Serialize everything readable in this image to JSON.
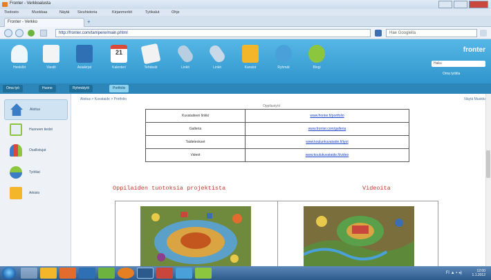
{
  "browser": {
    "window_title": "Fronter - Verkkoalusta",
    "menu": [
      "Tiedosto",
      "Muokkaa",
      "Näytä",
      "Sivuhistoria",
      "Kirjanmerkit",
      "Työkalut",
      "Ohje"
    ],
    "tab_label": "Fronter - Verkko",
    "url": "http://fronter.com/tampere/main.phtml",
    "search_placeholder": "Hae Googlella"
  },
  "app": {
    "brand": "fronter",
    "search_placeholder": "Haku",
    "top_link": "Oma työtila",
    "icons": [
      {
        "label": "Henkilöt",
        "icon": "person-icon",
        "color": "#ffffff"
      },
      {
        "label": "Viestit",
        "icon": "message-icon",
        "color": "#e8d35a"
      },
      {
        "label": "Asiakirjat",
        "icon": "documents-icon",
        "color": "#2f6fb3"
      },
      {
        "label": "Kalenteri",
        "icon": "calendar-icon",
        "color": "#d94a3a"
      },
      {
        "label": "Tehtävät",
        "icon": "tasks-icon",
        "color": "#f2f2f2"
      },
      {
        "label": "Linkit",
        "icon": "link-icon",
        "color": "#b8cfe2"
      },
      {
        "label": "Linkit",
        "icon": "link-icon",
        "color": "#c9d9e8"
      },
      {
        "label": "Kansiot",
        "icon": "folder-icon",
        "color": "#f3b62a"
      },
      {
        "label": "Ryhmät",
        "icon": "group-icon",
        "color": "#4aa0d8"
      },
      {
        "label": "Blogi",
        "icon": "blog-icon",
        "color": "#8cc63f"
      }
    ],
    "subtabs": [
      {
        "label": "Oma työ",
        "active": false
      },
      {
        "label": "Huone",
        "active": false
      },
      {
        "label": "Ryhmätyöt",
        "active": false
      },
      {
        "label": "Portfolio",
        "active": true
      }
    ]
  },
  "sidebar": {
    "items": [
      {
        "label": "Aloitus",
        "icon": "home-icon",
        "active": true
      },
      {
        "label": "Huoneen tiedot",
        "icon": "document-icon",
        "active": false
      },
      {
        "label": "Osallistujat",
        "icon": "people-icon",
        "active": false
      },
      {
        "label": "Työtilat",
        "icon": "workspace-icon",
        "active": false
      },
      {
        "label": "Arkisto",
        "icon": "archive-icon",
        "active": false
      }
    ]
  },
  "main": {
    "breadcrumb": "Aloitus > Kuvataide > Portfolio",
    "view_options": "Näytä  Muokkaa",
    "page_title": "Oppilastyöt",
    "links": [
      {
        "key": "Kuvataiteen linkki",
        "value": "www.fronter.fi/portfolio"
      },
      {
        "key": "Galleria",
        "value": "www.fronter.com/galleria"
      },
      {
        "key": "Taideteokset",
        "value": "www.koulunkuvataide.fi/tyot"
      },
      {
        "key": "Videot",
        "value": "www.koulukuvataide.fi/video"
      }
    ],
    "heading_left": "Oppilaiden tuotoksia projektista",
    "heading_right": "Videoita"
  },
  "taskbar": {
    "time": "12:00",
    "date": "1.1.2012",
    "tray": "FI  ▲  ▪  ◂)"
  },
  "colors": {
    "header": "#3aa2d6",
    "heading": "#c0392b",
    "link": "#1a44c8"
  }
}
